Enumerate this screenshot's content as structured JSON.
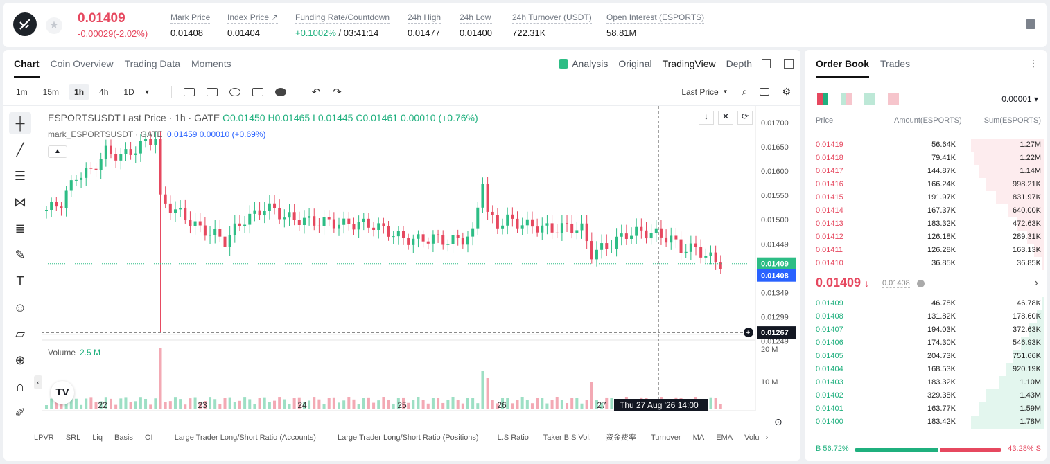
{
  "header": {
    "price": "0.01409",
    "change": "-0.00029(-2.02%)",
    "stats": [
      {
        "label": "Mark Price",
        "value": "0.01408"
      },
      {
        "label": "Index Price ↗",
        "value": "0.01404"
      },
      {
        "label": "Funding Rate/Countdown",
        "value": "+0.1002%",
        "value2": " / 03:41:14"
      },
      {
        "label": "24h High",
        "value": "0.01477"
      },
      {
        "label": "24h Low",
        "value": "0.01400"
      },
      {
        "label": "24h Turnover (USDT)",
        "value": "722.31K"
      },
      {
        "label": "Open Interest (ESPORTS)",
        "value": "58.81M"
      }
    ]
  },
  "chart_tabs": [
    "Chart",
    "Coin Overview",
    "Trading Data",
    "Moments"
  ],
  "view_tabs": [
    "Analysis",
    "Original",
    "TradingView",
    "Depth"
  ],
  "timeframes": [
    "1m",
    "15m",
    "1h",
    "4h",
    "1D"
  ],
  "price_source": "Last Price",
  "legend": {
    "symbol": "ESPORTSUSDT Last Price · 1h · GATE",
    "ohlc": "O0.01450 H0.01465 L0.01445 C0.01461 0.00010 (+0.76%)",
    "mark": "mark_ESPORTSUSDT · GATE",
    "mark_vals": "0.01459 0.00010 (+0.69%)"
  },
  "volume": {
    "label": "Volume",
    "value": "2.5 M"
  },
  "chart_data": {
    "type": "candlestick",
    "symbol": "ESPORTSUSDT",
    "interval": "1h",
    "yticks": [
      "0.01700",
      "0.01650",
      "0.01600",
      "0.01550",
      "0.01500",
      "0.01449",
      "0.01399",
      "0.01349",
      "0.01299",
      "0.01249"
    ],
    "xticks": [
      "22",
      "23",
      "24",
      "25",
      "26",
      "27"
    ],
    "vol_ticks": [
      "20 M",
      "10 M"
    ],
    "current_price": "0.01409",
    "mark_price": "0.01408",
    "crosshair_price": "0.01267",
    "crosshair_time": "Thu 27 Aug '26",
    "crosshair_hour": "14:00",
    "volume_last": "572 K",
    "close_path": [
      [
        0,
        0.0152
      ],
      [
        3,
        0.01535
      ],
      [
        6,
        0.0159
      ],
      [
        9,
        0.016
      ],
      [
        12,
        0.0164
      ],
      [
        15,
        0.0163
      ],
      [
        18,
        0.01645
      ],
      [
        20,
        0.0166
      ],
      [
        22,
        0.0167
      ],
      [
        23,
        0.0154
      ],
      [
        25,
        0.01525
      ],
      [
        28,
        0.01505
      ],
      [
        31,
        0.0148
      ],
      [
        34,
        0.0147
      ],
      [
        36,
        0.01455
      ],
      [
        38,
        0.0148
      ],
      [
        40,
        0.015
      ],
      [
        42,
        0.0151
      ],
      [
        44,
        0.01525
      ],
      [
        46,
        0.0152
      ],
      [
        48,
        0.01505
      ],
      [
        51,
        0.015
      ],
      [
        54,
        0.01495
      ],
      [
        57,
        0.01495
      ],
      [
        60,
        0.0149
      ],
      [
        63,
        0.01492
      ],
      [
        66,
        0.01488
      ],
      [
        69,
        0.01475
      ],
      [
        72,
        0.0146
      ],
      [
        75,
        0.01458
      ],
      [
        78,
        0.01462
      ],
      [
        81,
        0.01455
      ],
      [
        84,
        0.0146
      ],
      [
        86,
        0.0147
      ],
      [
        88,
        0.01585
      ],
      [
        89,
        0.0151
      ],
      [
        91,
        0.0149
      ],
      [
        93,
        0.015
      ],
      [
        96,
        0.0149
      ],
      [
        99,
        0.01485
      ],
      [
        102,
        0.0148
      ],
      [
        105,
        0.01485
      ],
      [
        108,
        0.0148
      ],
      [
        110,
        0.0143
      ],
      [
        112,
        0.0144
      ],
      [
        114,
        0.0145
      ],
      [
        117,
        0.0147
      ],
      [
        120,
        0.01475
      ],
      [
        123,
        0.0147
      ],
      [
        126,
        0.0146
      ],
      [
        128,
        0.0144
      ],
      [
        131,
        0.0144
      ],
      [
        134,
        0.0142
      ],
      [
        136,
        0.01409
      ]
    ]
  },
  "orderbook": {
    "tabs": [
      "Order Book",
      "Trades"
    ],
    "precision": "0.00001",
    "headers": [
      "Price",
      "Amount(ESPORTS)",
      "Sum(ESPORTS)"
    ],
    "asks": [
      {
        "p": "0.01419",
        "a": "56.64K",
        "s": "1.27M",
        "f": 1.0
      },
      {
        "p": "0.01418",
        "a": "79.41K",
        "s": "1.22M",
        "f": 0.96
      },
      {
        "p": "0.01417",
        "a": "144.87K",
        "s": "1.14M",
        "f": 0.9
      },
      {
        "p": "0.01416",
        "a": "166.24K",
        "s": "998.21K",
        "f": 0.79
      },
      {
        "p": "0.01415",
        "a": "191.97K",
        "s": "831.97K",
        "f": 0.66
      },
      {
        "p": "0.01414",
        "a": "167.37K",
        "s": "640.00K",
        "f": 0.5
      },
      {
        "p": "0.01413",
        "a": "183.32K",
        "s": "472.63K",
        "f": 0.37
      },
      {
        "p": "0.01412",
        "a": "126.18K",
        "s": "289.31K",
        "f": 0.23
      },
      {
        "p": "0.01411",
        "a": "126.28K",
        "s": "163.13K",
        "f": 0.13
      },
      {
        "p": "0.01410",
        "a": "36.85K",
        "s": "36.85K",
        "f": 0.03
      }
    ],
    "mid_price": "0.01409",
    "mid_arrow": "↓",
    "mid_mark": "0.01408",
    "bids": [
      {
        "p": "0.01409",
        "a": "46.78K",
        "s": "46.78K",
        "f": 0.03
      },
      {
        "p": "0.01408",
        "a": "131.82K",
        "s": "178.60K",
        "f": 0.1
      },
      {
        "p": "0.01407",
        "a": "194.03K",
        "s": "372.63K",
        "f": 0.21
      },
      {
        "p": "0.01406",
        "a": "174.30K",
        "s": "546.93K",
        "f": 0.31
      },
      {
        "p": "0.01405",
        "a": "204.73K",
        "s": "751.66K",
        "f": 0.42
      },
      {
        "p": "0.01404",
        "a": "168.53K",
        "s": "920.19K",
        "f": 0.52
      },
      {
        "p": "0.01403",
        "a": "183.32K",
        "s": "1.10M",
        "f": 0.62
      },
      {
        "p": "0.01402",
        "a": "329.38K",
        "s": "1.43M",
        "f": 0.8
      },
      {
        "p": "0.01401",
        "a": "163.77K",
        "s": "1.59M",
        "f": 0.89
      },
      {
        "p": "0.01400",
        "a": "183.42K",
        "s": "1.78M",
        "f": 1.0
      }
    ],
    "buy_ratio": "56.72%",
    "sell_ratio": "43.28%",
    "buy_label": "B",
    "sell_label": "S",
    "buy_fraction": 0.5672
  },
  "indicators": [
    "LPVR",
    "SRL",
    "Liq",
    "Basis",
    "OI",
    "Large Trader Long/Short Ratio (Accounts)",
    "Large Trader Long/Short Ratio (Positions)",
    "L.S Ratio",
    "Taker B.S Vol.",
    "资金费率",
    "Turnover",
    "MA",
    "EMA",
    "Volu"
  ]
}
